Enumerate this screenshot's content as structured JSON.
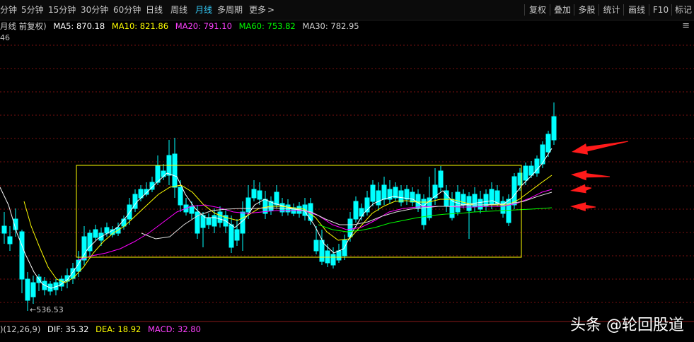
{
  "toolbar": {
    "periods": [
      {
        "label": "分钟"
      },
      {
        "label": "5分钟"
      },
      {
        "label": "15分钟"
      },
      {
        "label": "30分钟"
      },
      {
        "label": "60分钟"
      },
      {
        "label": "日线"
      },
      {
        "label": "周线"
      },
      {
        "label": "月线",
        "active": true
      },
      {
        "label": "多周期"
      },
      {
        "label": "更多"
      }
    ],
    "more_arrow": ">",
    "right_buttons": [
      "复权",
      "叠加",
      "多股",
      "统计",
      "画线",
      "F10",
      "标记"
    ]
  },
  "legend": {
    "title": "月线 前复权)",
    "ma5": "MA5: 870.18",
    "ma10": "MA10: 821.86",
    "ma20": "MA20: 791.10",
    "ma60": "MA60: 753.82",
    "ma30": "MA30: 782.95",
    "menu_icon": "≡"
  },
  "price_top_label": "46",
  "low_label": "←536.53",
  "macd": {
    "params": ")(12,26,9)",
    "dif": "DIF: 35.32",
    "dea": "DEA: 18.92",
    "macd": "MACD: 32.80"
  },
  "watermark": "头条 @轮回股道",
  "colors": {
    "up": "#ff3232",
    "down": "#00ffff",
    "ma5": "#ffffff",
    "ma10": "#ffff00",
    "ma20": "#ff00ff",
    "ma30": "#e0e0e0",
    "ma60": "#00ff00",
    "box": "#ffff00",
    "grid": "#7a1010",
    "arrow": "#ff1a1a"
  },
  "chart_data": {
    "type": "candlestick",
    "title": "",
    "overlays": [
      "MA5",
      "MA10",
      "MA20",
      "MA30",
      "MA60",
      "consolidation box",
      "4 red arrows"
    ],
    "price_low_marked": 536.53
  }
}
